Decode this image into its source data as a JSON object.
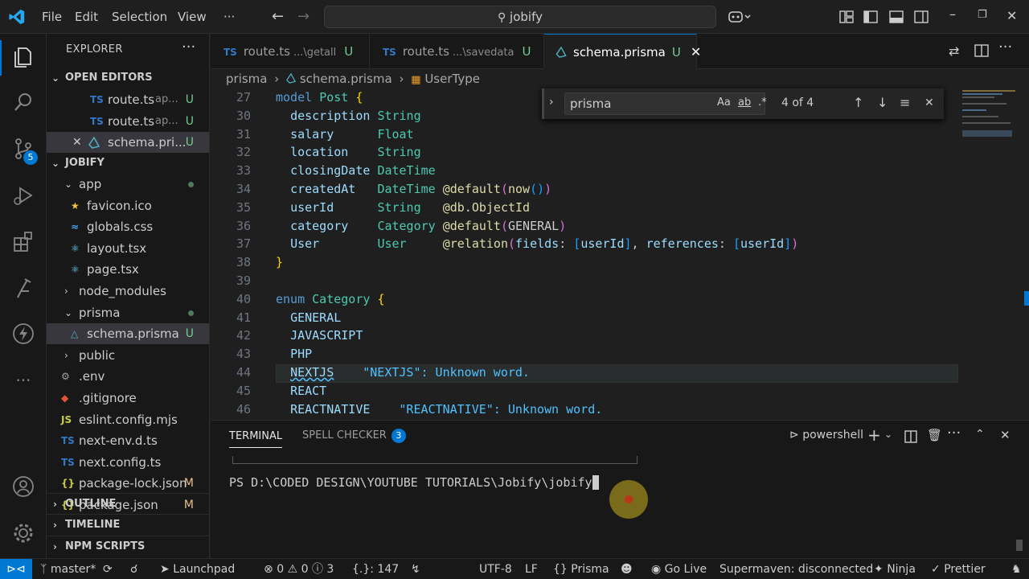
{
  "titlebar": {
    "menu": [
      "File",
      "Edit",
      "Selection",
      "View",
      "···"
    ],
    "search": "jobify"
  },
  "activity": {
    "source_control_badge": "5"
  },
  "sidebar": {
    "title": "EXPLORER",
    "open_editors_label": "OPEN EDITORS",
    "open_editors": [
      {
        "type": "TS",
        "name": "route.ts",
        "hint": "ap...",
        "status": "U"
      },
      {
        "type": "TS",
        "name": "route.ts",
        "hint": "ap...",
        "status": "U"
      },
      {
        "type": "prisma",
        "name": "schema.pri...",
        "hint": "",
        "status": "U"
      }
    ],
    "project_label": "JOBIFY",
    "tree": [
      {
        "name": "app",
        "kind": "folder-open",
        "indent": 1,
        "dot": true
      },
      {
        "name": "favicon.ico",
        "kind": "star",
        "indent": 2
      },
      {
        "name": "globals.css",
        "kind": "css",
        "indent": 2
      },
      {
        "name": "layout.tsx",
        "kind": "react",
        "indent": 2
      },
      {
        "name": "page.tsx",
        "kind": "react",
        "indent": 2
      },
      {
        "name": "node_modules",
        "kind": "folder",
        "indent": 1
      },
      {
        "name": "prisma",
        "kind": "folder-open",
        "indent": 1,
        "dot": true
      },
      {
        "name": "schema.prisma",
        "kind": "prisma",
        "indent": 2,
        "status": "U"
      },
      {
        "name": "public",
        "kind": "folder",
        "indent": 1
      },
      {
        "name": ".env",
        "kind": "gear",
        "indent": 1
      },
      {
        "name": ".gitignore",
        "kind": "git",
        "indent": 1
      },
      {
        "name": "eslint.config.mjs",
        "kind": "JS",
        "indent": 1
      },
      {
        "name": "next-env.d.ts",
        "kind": "TS",
        "indent": 1
      },
      {
        "name": "next.config.ts",
        "kind": "TS",
        "indent": 1
      },
      {
        "name": "package-lock.json",
        "kind": "json",
        "indent": 1,
        "status": "M"
      },
      {
        "name": "package.json",
        "kind": "json",
        "indent": 1,
        "status": "M"
      }
    ],
    "bottom_sections": [
      "OUTLINE",
      "TIMELINE",
      "NPM SCRIPTS"
    ]
  },
  "tabs": [
    {
      "type": "TS",
      "name": "route.ts",
      "path": "...\\getall",
      "status": "U",
      "active": false
    },
    {
      "type": "TS",
      "name": "route.ts",
      "path": "...\\savedata",
      "status": "U",
      "active": false
    },
    {
      "type": "prisma",
      "name": "schema.prisma",
      "path": "",
      "status": "U",
      "active": true
    }
  ],
  "breadcrumb": {
    "folder": "prisma",
    "file": "schema.prisma",
    "symbol": "UserType"
  },
  "find": {
    "query": "prisma",
    "case": "Aa",
    "word": "ab",
    "regex": ".*",
    "count": "4 of 4"
  },
  "editor": {
    "lines": [
      {
        "n": "27",
        "html": "<span class='kw'>model</span> <span class='ty'>Post</span> <span class='br'>{</span>"
      },
      {
        "n": "30",
        "html": "  <span class='fld'>description</span> <span class='ty'>String</span>"
      },
      {
        "n": "31",
        "html": "  <span class='fld'>salary</span>      <span class='ty'>Float</span>"
      },
      {
        "n": "32",
        "html": "  <span class='fld'>location</span>    <span class='ty'>String</span>"
      },
      {
        "n": "33",
        "html": "  <span class='fld'>closingDate</span> <span class='ty'>DateTime</span>"
      },
      {
        "n": "34",
        "html": "  <span class='fld'>createdAt</span>   <span class='ty'>DateTime</span> <span class='fn'>@default</span><span class='br2'>(</span><span class='fn'>now</span><span class='br3'>()</span><span class='br2'>)</span>"
      },
      {
        "n": "35",
        "html": "  <span class='fld'>userId</span>      <span class='ty'>String</span>   <span class='fn'>@db.ObjectId</span>"
      },
      {
        "n": "36",
        "html": "  <span class='fld'>category</span>    <span class='ty'>Category</span> <span class='fn'>@default</span><span class='br2'>(</span>GENERAL<span class='br2'>)</span>"
      },
      {
        "n": "37",
        "html": "  <span class='fld'>User</span>        <span class='ty'>User</span>     <span class='fn'>@relation</span><span class='br2'>(</span><span class='fld'>fields</span>: <span class='br3'>[</span><span class='fld'>userId</span><span class='br3'>]</span>, <span class='fld'>references</span>: <span class='br3'>[</span><span class='fld'>userId</span><span class='br3'>]</span><span class='br2'>)</span>"
      },
      {
        "n": "38",
        "html": "<span class='br'>}</span>"
      },
      {
        "n": "39",
        "html": ""
      },
      {
        "n": "40",
        "html": "<span class='kw'>enum</span> <span class='ty'>Category</span> <span class='br'>{</span>"
      },
      {
        "n": "41",
        "html": "  <span class='fld'>GENERAL</span>"
      },
      {
        "n": "42",
        "html": "  <span class='fld'>JAVASCRIPT</span>"
      },
      {
        "n": "43",
        "html": "  <span class='fld'>PHP</span>"
      },
      {
        "n": "44",
        "html": "  <span class='fld' style='text-decoration: underline wavy #4fc1ff'>NEXTJS</span><span class='hint'>\"NEXTJS\": Unknown word.</span>",
        "highlight": true
      },
      {
        "n": "45",
        "html": "  <span class='fld'>REACT</span>"
      },
      {
        "n": "46",
        "html": "  <span class='fld'>REACTNATIVE</span><span class='hint'>\"REACTNATIVE\": Unknown word.</span>"
      }
    ]
  },
  "panel": {
    "tabs": [
      {
        "label": "TERMINAL",
        "active": true
      },
      {
        "label": "SPELL CHECKER",
        "badge": "3",
        "active": false
      }
    ],
    "shell": "powershell",
    "prompt": "PS D:\\CODED DESIGN\\YOUTUBE TUTORIALS\\Jobify\\jobify> "
  },
  "statusbar": {
    "branch": "master*",
    "launchpad": "Launchpad",
    "problems": {
      "errors": "0",
      "warnings": "0",
      "info": "3"
    },
    "braces": "{.}: 147",
    "encoding": "UTF-8",
    "eol": "LF",
    "language": "Prisma",
    "golive": "Go Live",
    "supermaven": "Supermaven: disconnected",
    "ninja": "Ninja",
    "prettier": "Prettier"
  },
  "colors": {
    "accent": "#0078d4",
    "untracked": "#73c991",
    "modified": "#e2c08d"
  }
}
